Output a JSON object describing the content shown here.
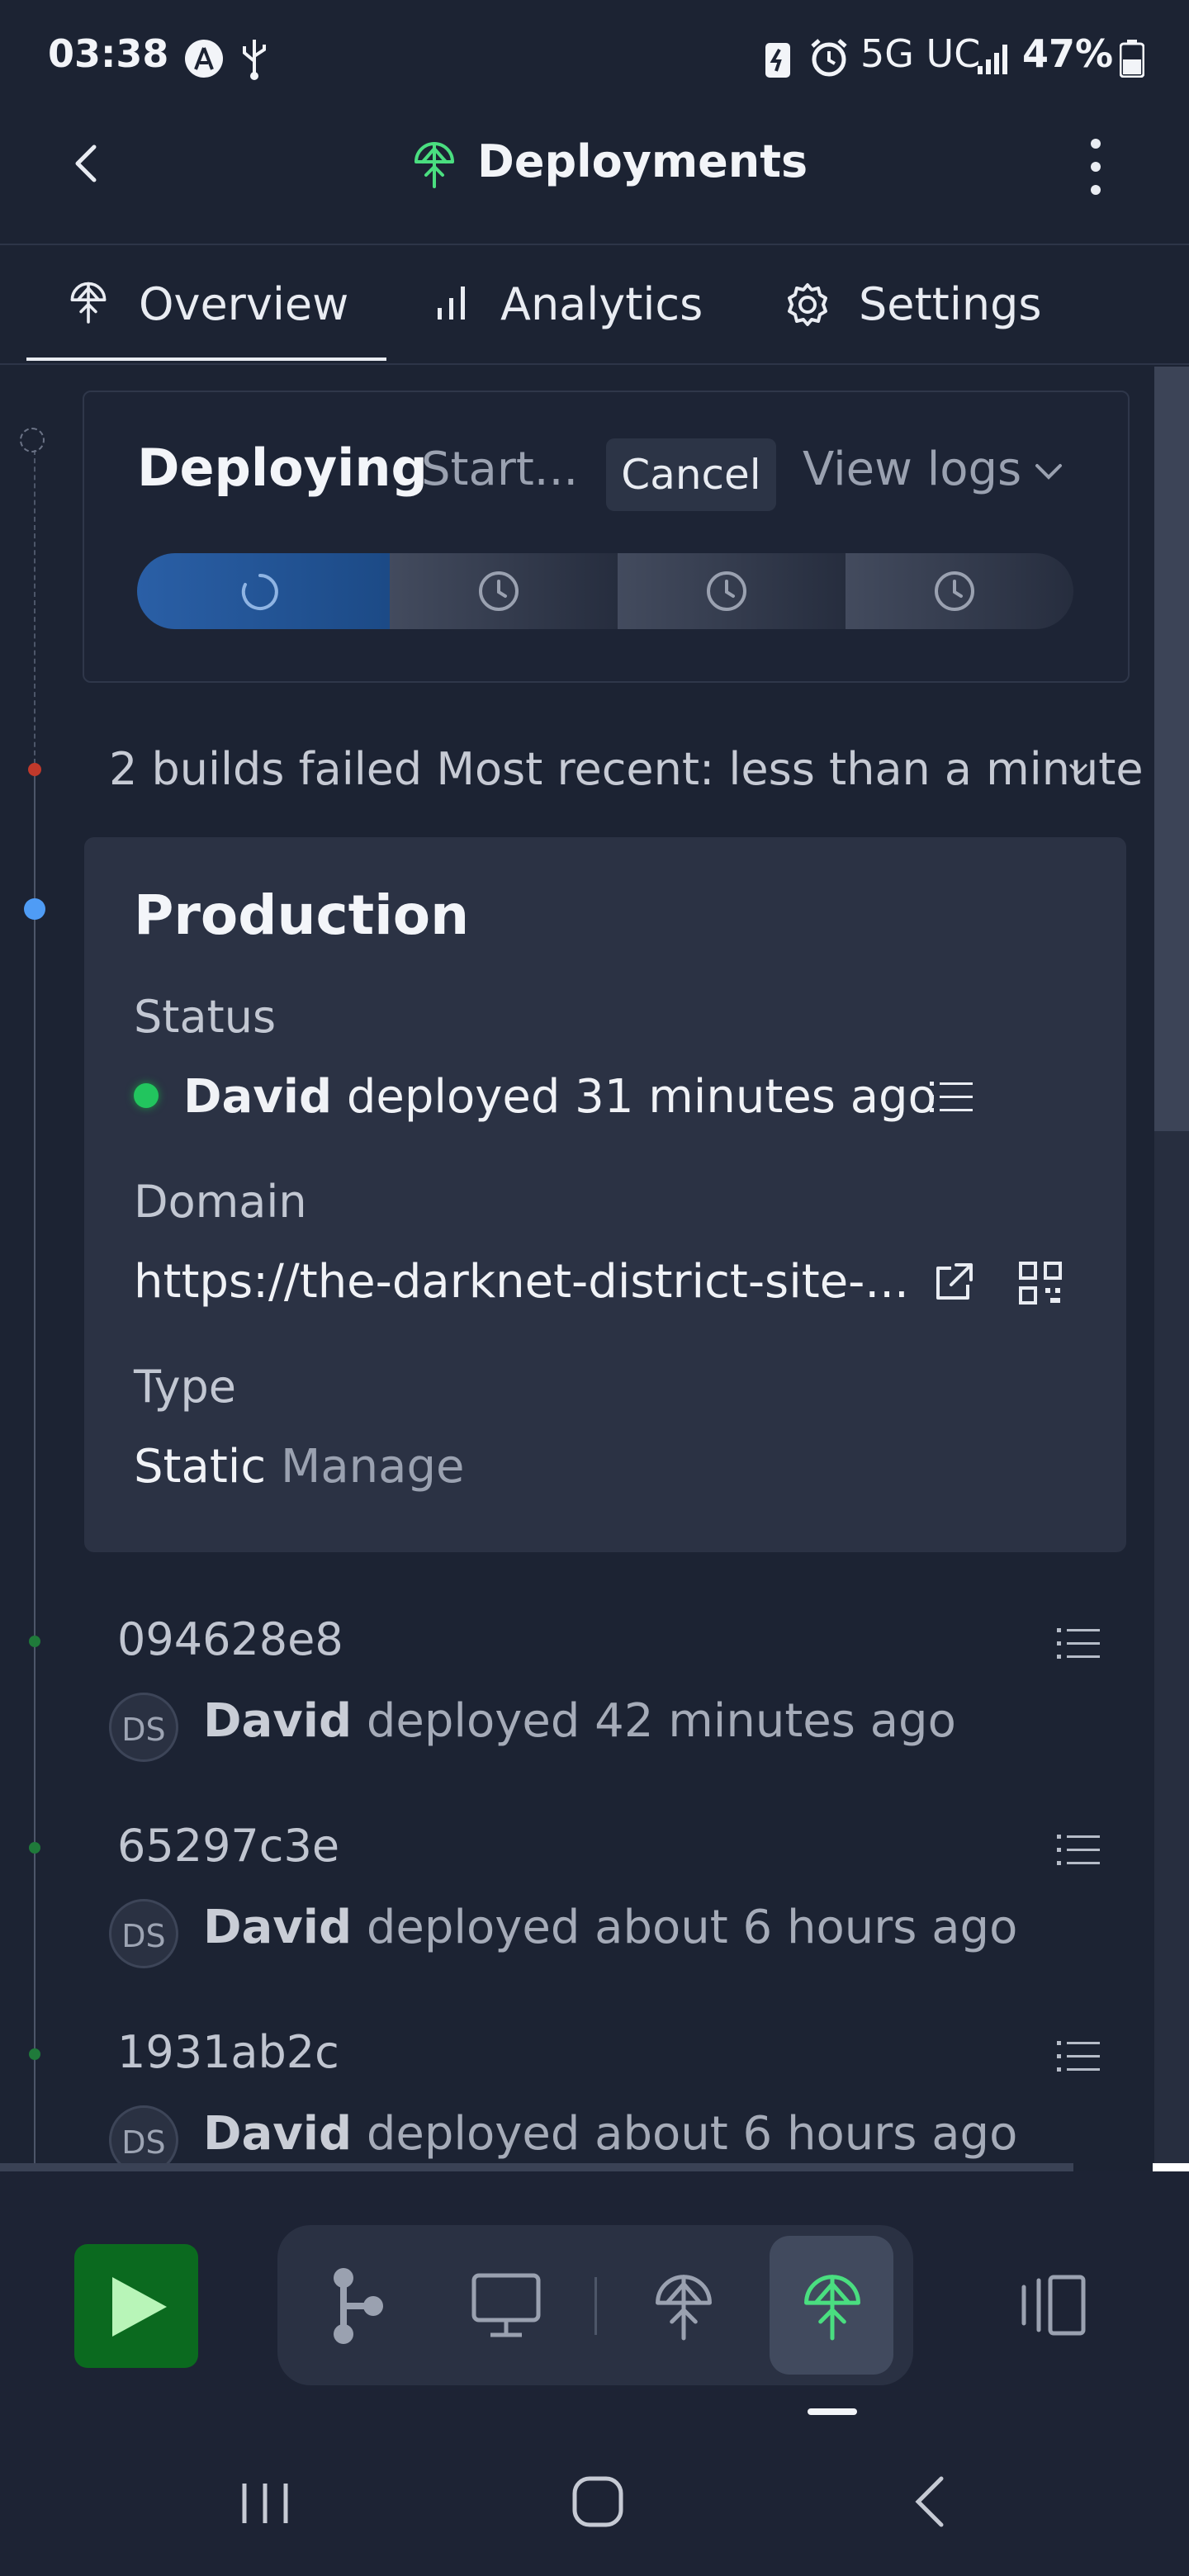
{
  "status_bar": {
    "time": "03:38",
    "network": "5G UC",
    "battery": "47%"
  },
  "app_bar": {
    "title": "Deployments",
    "back_icon": "chevron-left-icon",
    "menu_icon": "kebab-menu-icon",
    "title_icon": "deploy-tree-icon",
    "title_icon_color": "#4ade80"
  },
  "tabs": [
    {
      "label": "Overview",
      "icon": "deploy-tree-icon",
      "active": true
    },
    {
      "label": "Analytics",
      "icon": "bar-chart-icon",
      "active": false
    },
    {
      "label": "Settings",
      "icon": "gear-icon",
      "active": false
    }
  ],
  "deploying": {
    "title": "Deploying",
    "status": "Start...",
    "cancel_label": "Cancel",
    "view_logs_label": "View logs",
    "active_color": "#1f4b86"
  },
  "failed_summary": "2 builds failed  Most recent: less than a minute",
  "production": {
    "title": "Production",
    "status_label": "Status",
    "status_user": "David",
    "status_text": "deployed 31 minutes ago",
    "domain_label": "Domain",
    "domain_value": "https://the-darknet-district-site-...",
    "type_label": "Type",
    "type_value": "Static",
    "manage_label": "Manage",
    "status_color": "#22c55e"
  },
  "deployments": [
    {
      "hash": "094628e8",
      "avatar": "DS",
      "user": "David",
      "text": "deployed 42 minutes ago"
    },
    {
      "hash": "65297c3e",
      "avatar": "DS",
      "user": "David",
      "text": "deployed about 6 hours ago"
    },
    {
      "hash": "1931ab2c",
      "avatar": "DS",
      "user": "David",
      "text": "deployed about 6 hours ago"
    }
  ],
  "colors": {
    "background": "#1c2333",
    "card": "#2b3244",
    "run_button": "#0b6a1f",
    "success_dot": "#1f7a3a",
    "failed_dot": "#c0392b",
    "current_dot": "#4f9cf5"
  }
}
